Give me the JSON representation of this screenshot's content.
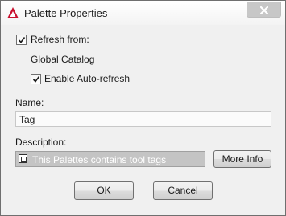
{
  "window": {
    "title": "Palette Properties"
  },
  "titlebar": {
    "app_icon": "autocad-a-icon",
    "close_icon": "close-x-icon"
  },
  "refresh": {
    "label": "Refresh from:",
    "checked": true,
    "source": "Global Catalog"
  },
  "auto_refresh": {
    "label": "Enable Auto-refresh",
    "checked": true
  },
  "name": {
    "label": "Name:",
    "value": "Tag"
  },
  "description": {
    "label": "Description:",
    "value": "This Palettes contains tool tags",
    "icon": "ellipsis-box-icon"
  },
  "buttons": {
    "more_info": "More Info",
    "ok": "OK",
    "cancel": "Cancel"
  },
  "colors": {
    "brand_red": "#c8102e",
    "window_bg": "#f0f0f0",
    "description_bg": "#c4c4c4"
  }
}
